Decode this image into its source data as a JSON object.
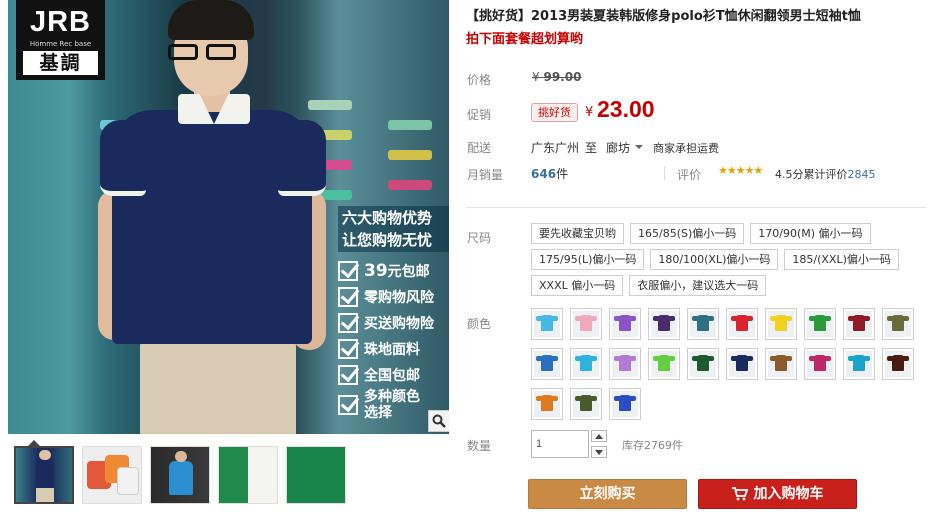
{
  "brand": {
    "logo_main": "JRB",
    "logo_sub": "Homme Rec base",
    "logo_cn": "基調"
  },
  "gallery": {
    "promo_title_line1": "六大购物优势",
    "promo_title_line2": "让您购物无忧",
    "promo_items": [
      "39元包邮",
      "零购物风险",
      "买送购物险",
      "珠地面料",
      "全国包邮",
      "多种颜色选择"
    ],
    "promo_first_bold": "39",
    "promo_first_rest": "元包邮",
    "promo_last_line1": "多种颜色",
    "promo_last_line2": "选择",
    "zoom_icon": "magnifier-icon",
    "thumbnails": [
      {
        "name": "navy-model",
        "color": "#1a2a5c"
      },
      {
        "name": "red-orange-shirts",
        "color": "#e05a3a"
      },
      {
        "name": "blue-model",
        "color": "#2a8ed0"
      },
      {
        "name": "green-white-fabric",
        "color": "#1f8a4a"
      },
      {
        "name": "green-fabric",
        "color": "#17844a"
      }
    ]
  },
  "product": {
    "title": "【挑好货】2013男装夏装韩版修身polo衫T恤休闲翻领男士短袖t恤",
    "subtitle": "拍下面套餐超划算哟"
  },
  "price": {
    "label": "价格",
    "currency": "¥",
    "original": "99.00",
    "promo_label": "促销",
    "promo_tag": "挑好货",
    "current": "23.00"
  },
  "shipping": {
    "label": "配送",
    "from": "广东广州",
    "to_word": "至",
    "to": "廊坊",
    "note": "商家承担运费"
  },
  "sales": {
    "label": "月销量",
    "count": "646",
    "unit": "件",
    "rating_label": "评价",
    "stars": "★★★★★",
    "rating_text": "4.5分",
    "review_prefix": "累计评价",
    "review_count": "2845"
  },
  "size": {
    "label": "尺码",
    "options": [
      "要先收藏宝贝哟",
      "165/85(S)偏小一码",
      "170/90(M) 偏小一码",
      "175/95(L)偏小一码",
      "180/100(XL)偏小一码",
      "185/(XXL)偏小一码",
      "XXXL 偏小一码",
      "衣服偏小，建议选大一码"
    ]
  },
  "color": {
    "label": "颜色",
    "swatches": [
      {
        "name": "light-blue",
        "hex": "#47b7e6"
      },
      {
        "name": "pink",
        "hex": "#f1a8bf"
      },
      {
        "name": "purple",
        "hex": "#8b55c9"
      },
      {
        "name": "dark-purple",
        "hex": "#4c2a6e"
      },
      {
        "name": "teal-model",
        "hex": "#2f6f82"
      },
      {
        "name": "red",
        "hex": "#d8242c"
      },
      {
        "name": "yellow",
        "hex": "#f0d020"
      },
      {
        "name": "green",
        "hex": "#2a9a3a"
      },
      {
        "name": "burgundy",
        "hex": "#8e1b27"
      },
      {
        "name": "olive-model",
        "hex": "#6a6a3a"
      },
      {
        "name": "royal-blue",
        "hex": "#2a6fc2"
      },
      {
        "name": "sky-blue",
        "hex": "#2fb3de"
      },
      {
        "name": "lilac",
        "hex": "#b27ad6"
      },
      {
        "name": "lime",
        "hex": "#66cc44"
      },
      {
        "name": "dark-green",
        "hex": "#1e5a2e"
      },
      {
        "name": "navy",
        "hex": "#1a2a5c"
      },
      {
        "name": "brown-model",
        "hex": "#8a5a2a"
      },
      {
        "name": "magenta",
        "hex": "#c0266a"
      },
      {
        "name": "cyan",
        "hex": "#1aa3c9"
      },
      {
        "name": "dark-brown",
        "hex": "#4a1c10"
      },
      {
        "name": "orange-model",
        "hex": "#e07a22"
      },
      {
        "name": "army-green",
        "hex": "#4a5a2a"
      },
      {
        "name": "cobalt",
        "hex": "#2a4ec2"
      }
    ]
  },
  "quantity": {
    "label": "数量",
    "value": "1",
    "stock_text": "库存2769件"
  },
  "actions": {
    "buy_now": "立刻购买",
    "add_to_cart": "加入购物车",
    "cart_icon": "cart-icon"
  }
}
